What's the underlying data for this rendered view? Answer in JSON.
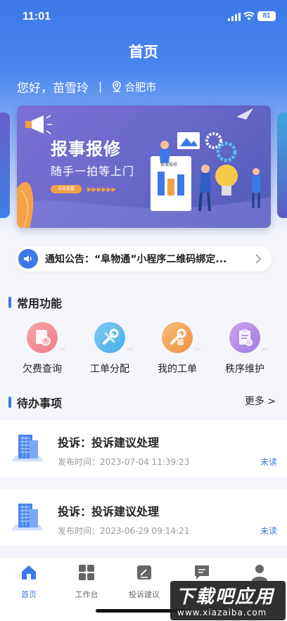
{
  "status_bar": {
    "time": "11:01",
    "battery": "81"
  },
  "header": {
    "title": "首页",
    "greeting": "您好，苗雪玲",
    "separator": "|",
    "city": "合肥市"
  },
  "banner": {
    "title": "报事报修",
    "subtitle": "随手一拍等上门",
    "button": "点击查看",
    "poster_text": "报事报修",
    "accent": "#f0a04a"
  },
  "notice": {
    "text": "通知公告：“阜物通”小程序二维码绑定..."
  },
  "functions": {
    "title": "常用功能",
    "items": [
      {
        "label": "欠费查询",
        "icon": "bill-icon",
        "color": "#f1888f"
      },
      {
        "label": "工单分配",
        "icon": "wrench-icon",
        "color": "#5bb7ef"
      },
      {
        "label": "我的工单",
        "icon": "tools-icon",
        "color": "#f3a155"
      },
      {
        "label": "秩序维护",
        "icon": "clipboard-icon",
        "color": "#b08ae6"
      }
    ]
  },
  "todo": {
    "title": "待办事项",
    "more": "更多 >",
    "items": [
      {
        "title": "投诉：投诉建议处理",
        "time": "发布时间：2023-07-04 11:39:23",
        "status": "未读"
      },
      {
        "title": "投诉：投诉建议处理",
        "time": "发布时间：2023-06-29 09:14:21",
        "status": "未读"
      }
    ]
  },
  "tabbar": {
    "items": [
      {
        "label": "首页",
        "icon": "home-icon"
      },
      {
        "label": "工作台",
        "icon": "grid-icon"
      },
      {
        "label": "投诉建议",
        "icon": "edit-icon"
      },
      {
        "label": "消息",
        "icon": "message-icon"
      },
      {
        "label": "我的",
        "icon": "user-icon"
      }
    ],
    "active_color": "#3d79e6"
  },
  "watermark": {
    "main": "下载吧应用",
    "url": "www.xiazaiba.com"
  }
}
